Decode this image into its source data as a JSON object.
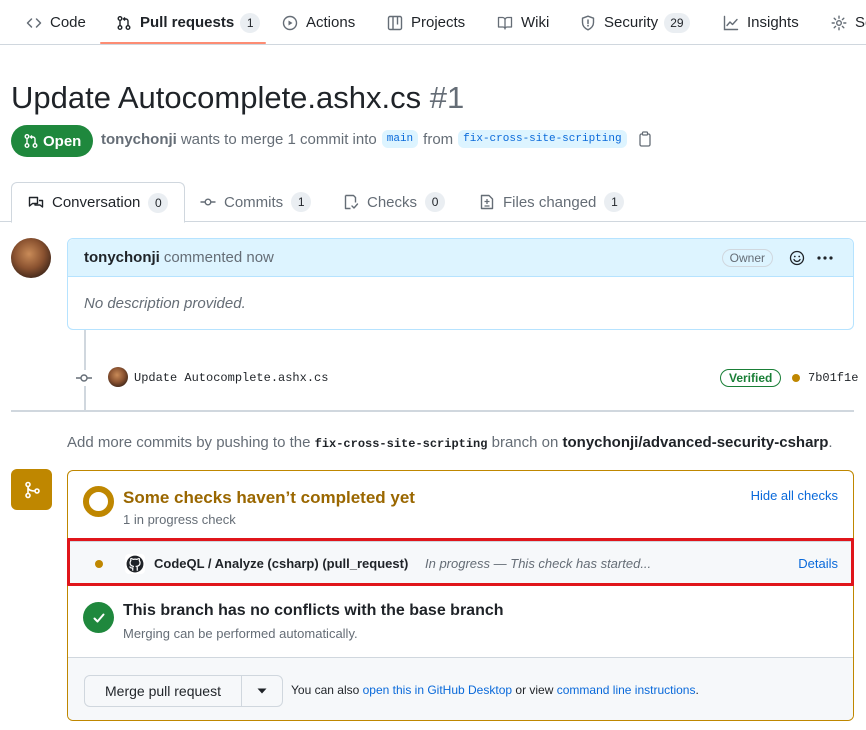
{
  "repo_nav": {
    "tabs": [
      {
        "label": "Code",
        "icon": "code-icon"
      },
      {
        "label": "Pull requests",
        "icon": "git-pull-request-icon",
        "count": "1",
        "selected": true
      },
      {
        "label": "Actions",
        "icon": "play-icon"
      },
      {
        "label": "Projects",
        "icon": "table-icon"
      },
      {
        "label": "Wiki",
        "icon": "book-icon"
      },
      {
        "label": "Security",
        "icon": "shield-icon",
        "count": "29"
      },
      {
        "label": "Insights",
        "icon": "graph-icon"
      },
      {
        "label": "Se",
        "icon": "gear-icon"
      }
    ]
  },
  "pr": {
    "title": "Update Autocomplete.ashx.cs",
    "number": "#1",
    "state": "Open",
    "author": "tonychonji",
    "merge_text": "wants to merge 1 commit into",
    "base_branch": "main",
    "from_text": "from",
    "head_branch": "fix-cross-site-scripting"
  },
  "pr_tabs": [
    {
      "label": "Conversation",
      "count": "0"
    },
    {
      "label": "Commits",
      "count": "1"
    },
    {
      "label": "Checks",
      "count": "0"
    },
    {
      "label": "Files changed",
      "count": "1"
    }
  ],
  "comment": {
    "author": "tonychonji",
    "action": "commented now",
    "badge": "Owner",
    "body": "No description provided."
  },
  "commit": {
    "message": "Update Autocomplete.ashx.cs",
    "verified": "Verified",
    "sha": "7b01f1e"
  },
  "push_note": {
    "prefix": "Add more commits by pushing to the",
    "branch": "fix-cross-site-scripting",
    "middle": "branch on",
    "repo": "tonychonji/advanced-security-csharp",
    "suffix": "."
  },
  "checks": {
    "title": "Some checks haven’t completed yet",
    "subtitle": "1 in progress check",
    "hide_label": "Hide all checks",
    "row": {
      "name": "CodeQL / Analyze (csharp) (pull_request)",
      "status": "In progress — This check has started...",
      "details": "Details"
    }
  },
  "conflicts": {
    "title": "This branch has no conflicts with the base branch",
    "subtitle": "Merging can be performed automatically."
  },
  "merge": {
    "button": "Merge pull request",
    "note_prefix": "You can also",
    "desktop_link": "open this in GitHub Desktop",
    "note_middle": "or view",
    "cli_link": "command line instructions",
    "note_suffix": "."
  },
  "colors": {
    "accent_blue": "#0969da",
    "success_green": "#1f883d",
    "pending_yellow": "#bf8700",
    "highlight_red": "#e0151b"
  }
}
